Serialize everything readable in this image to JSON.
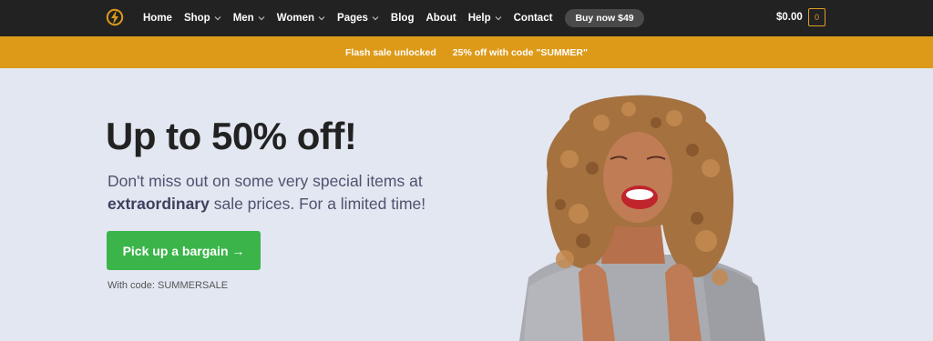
{
  "header": {
    "logo_icon": "lightning-bolt-icon",
    "menu": [
      {
        "label": "Home",
        "dropdown": false
      },
      {
        "label": "Shop",
        "dropdown": true
      },
      {
        "label": "Men",
        "dropdown": true
      },
      {
        "label": "Women",
        "dropdown": true
      },
      {
        "label": "Pages",
        "dropdown": true
      },
      {
        "label": "Blog",
        "dropdown": false
      },
      {
        "label": "About",
        "dropdown": false
      },
      {
        "label": "Help",
        "dropdown": true
      },
      {
        "label": "Contact",
        "dropdown": false
      }
    ],
    "buy_button": "Buy now $49",
    "cart_total": "$0.00",
    "cart_count": "0"
  },
  "promo": {
    "left": "Flash sale unlocked",
    "right": "25% off with code \"SUMMER\""
  },
  "hero": {
    "title": "Up to 50% off!",
    "text_pre": "Don't miss out on some very special items at ",
    "text_bold": "extraordinary",
    "text_post": " sale prices. For a limited time!",
    "cta": "Pick up a bargain →",
    "code_note": "With code: SUMMERSALE"
  },
  "colors": {
    "nav_bg": "#222222",
    "accent": "#dd9a19",
    "hero_bg": "#e2e7f1",
    "cta": "#3bb54a"
  }
}
